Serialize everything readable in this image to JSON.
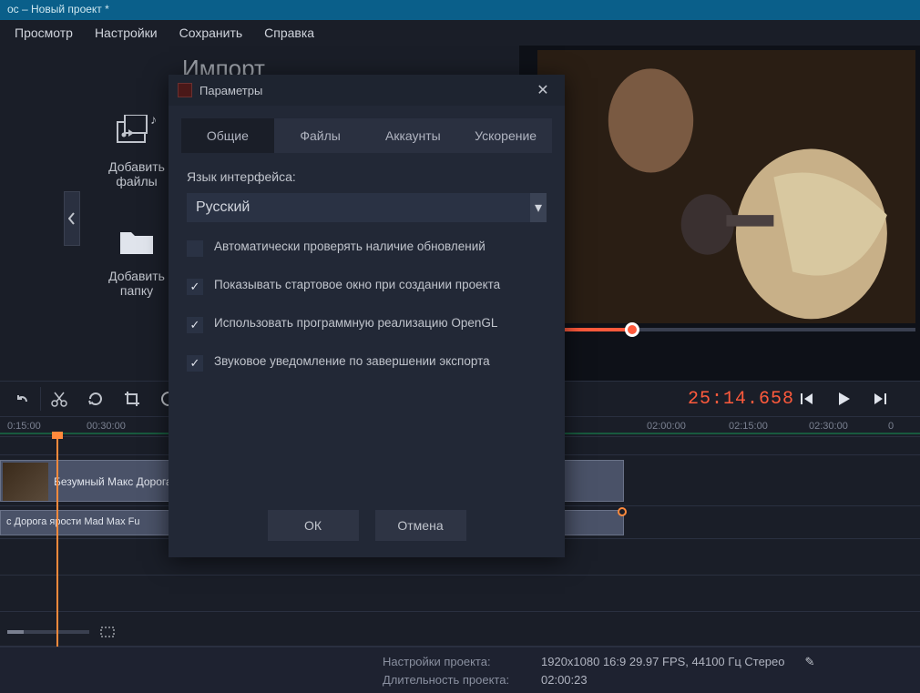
{
  "title": "ос – Новый проект *",
  "menubar": [
    "Просмотр",
    "Настройки",
    "Сохранить",
    "Справка"
  ],
  "import": {
    "heading": "Импорт",
    "add_files": "Добавить\nфайлы",
    "add_folder": "Добавить\nпапку"
  },
  "timecode": "25:14.658",
  "ruler_ticks": [
    {
      "pos": 8,
      "label": "0:15:00"
    },
    {
      "pos": 95,
      "label": "00:30:00"
    },
    {
      "pos": 710,
      "label": "02:00:00"
    },
    {
      "pos": 800,
      "label": "02:15:00"
    },
    {
      "pos": 888,
      "label": "02:30:00"
    },
    {
      "pos": 975,
      "label": "0"
    }
  ],
  "clips": {
    "video_label": "Безумный Макс Дорога ярости",
    "audio_label": "с Дорога ярости  Mad Max Fu"
  },
  "status": {
    "settings_label": "Настройки проекта:",
    "settings_val": "1920x1080 16:9 29.97 FPS, 44100 Гц Стерео",
    "duration_label": "Длительность проекта:",
    "duration_val": "02:00:23"
  },
  "dialog": {
    "title": "Параметры",
    "tabs": [
      "Общие",
      "Файлы",
      "Аккаунты",
      "Ускорение"
    ],
    "lang_label": "Язык интерфейса:",
    "lang_value": "Русский",
    "chk1": "Автоматически проверять наличие обновлений",
    "chk2": "Показывать стартовое окно при создании проекта",
    "chk3": "Использовать программную реализацию OpenGL",
    "chk4": "Звуковое уведомление по завершении экспорта",
    "ok": "ОК",
    "cancel": "Отмена"
  }
}
